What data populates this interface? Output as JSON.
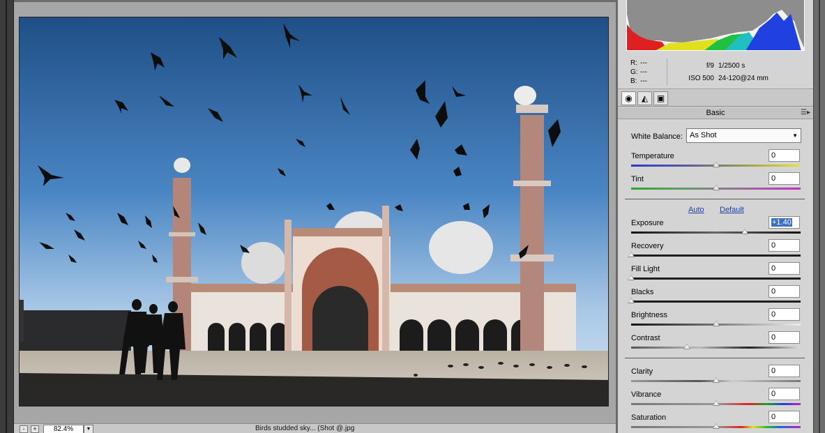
{
  "info": {
    "r_label": "R:",
    "r_value": "---",
    "g_label": "G:",
    "g_value": "---",
    "b_label": "B:",
    "b_value": "---",
    "aperture": "f/9",
    "shutter": "1/2500 s",
    "iso": "ISO 500",
    "lens": "24-120@24 mm"
  },
  "tabs": [
    {
      "icon": "aperture-icon"
    },
    {
      "icon": "tone-curve-icon"
    },
    {
      "icon": "camera-icon"
    }
  ],
  "panel": {
    "title": "Basic",
    "white_balance_label": "White Balance:",
    "white_balance_value": "As Shot",
    "auto_label": "Auto",
    "default_label": "Default",
    "sliders": [
      {
        "label": "Temperature",
        "value": "0",
        "level": 0.5
      },
      {
        "label": "Tint",
        "value": "0",
        "level": 0.5
      },
      {
        "label": "Exposure",
        "value": "+1.40",
        "level": 0.67
      },
      {
        "label": "Recovery",
        "value": "0",
        "level": 0.0
      },
      {
        "label": "Fill Light",
        "value": "0",
        "level": 0.0
      },
      {
        "label": "Blacks",
        "value": "0",
        "level": 0.0
      },
      {
        "label": "Brightness",
        "value": "0",
        "level": 0.5
      },
      {
        "label": "Contrast",
        "value": "0",
        "level": 0.33
      },
      {
        "label": "Clarity",
        "value": "0",
        "level": 0.5
      },
      {
        "label": "Vibrance",
        "value": "0",
        "level": 0.5
      },
      {
        "label": "Saturation",
        "value": "0",
        "level": 0.5
      }
    ]
  },
  "statusbar": {
    "zoom_out": "-",
    "zoom_in": "+",
    "zoom_value": "82.4%",
    "filename": "Birds studded sky... (Shot @.jpg"
  },
  "colors": {
    "panel_bg": "#d4d4d4",
    "preview_bg": "#a6a6a6",
    "link": "#1d3fa8",
    "selection": "#3a6fc4"
  }
}
